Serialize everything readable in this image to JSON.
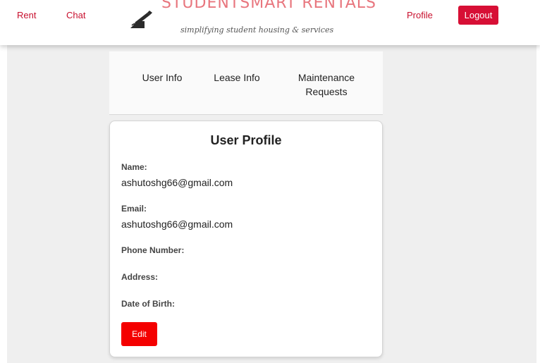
{
  "header": {
    "nav": {
      "rent": "Rent",
      "chat": "Chat",
      "profile": "Profile",
      "logout": "Logout"
    },
    "brand": {
      "title": "STUDENTSMART RENTALS",
      "tagline": "simplifying student housing & services"
    },
    "accent_color": "#d70f35",
    "logo_icon": "pen-writing-icon"
  },
  "tabs": [
    {
      "label": "User Info"
    },
    {
      "label": "Lease Info"
    },
    {
      "label": "Maintenance Requests"
    }
  ],
  "profile": {
    "title": "User Profile",
    "fields": [
      {
        "label": "Name:",
        "value": "ashutoshg66@gmail.com"
      },
      {
        "label": "Email:",
        "value": "ashutoshg66@gmail.com"
      },
      {
        "label": "Phone Number:",
        "value": ""
      },
      {
        "label": "Address:",
        "value": ""
      },
      {
        "label": "Date of Birth:",
        "value": ""
      }
    ],
    "edit_label": "Edit",
    "edit_color": "#f40000"
  }
}
